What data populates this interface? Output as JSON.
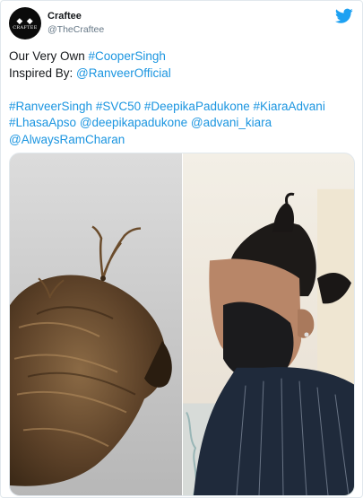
{
  "account": {
    "name": "Craftee",
    "handle": "@TheCraftee",
    "avatar_text": "CRAFTEE",
    "avatar_glyph": "◆ ◆"
  },
  "tweet": {
    "line1": {
      "text": "Our Very Own ",
      "link": "#CooperSingh"
    },
    "line2": {
      "text": "Inspired By: ",
      "link": "@RanveerOfficial"
    },
    "line3": [
      "#RanveerSingh",
      "#SVC50",
      "#DeepikaPadukone",
      "#KiaraAdvani"
    ],
    "line4": [
      "#LhasaApso",
      "@deepikapadukone",
      "@advani_kiara"
    ],
    "line5": [
      "@AlwaysRamCharan"
    ]
  },
  "icons": {
    "brand": "twitter-bird-icon"
  },
  "colors": {
    "link": "#1b95e0",
    "twitter_blue": "#1da1f2",
    "text": "#14171a",
    "muted": "#657786"
  }
}
